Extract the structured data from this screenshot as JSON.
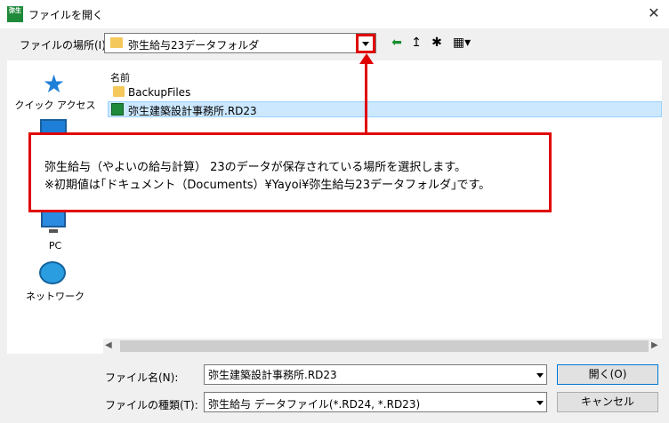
{
  "window": {
    "title": "ファイルを開く",
    "app_icon_text": "弥生",
    "close_glyph": "✕"
  },
  "location": {
    "label": "ファイルの場所(I):",
    "value": "弥生給与23データフォルダ"
  },
  "toolbar": {
    "back_glyph": "⬅",
    "up_glyph": "↥",
    "newfolder_glyph": "✱",
    "view_glyph": "▦▾"
  },
  "sidebar": {
    "items": [
      {
        "label": "クイック アクセス"
      },
      {
        "label": "PC"
      },
      {
        "label": "ネットワーク"
      }
    ]
  },
  "filelist": {
    "column_name": "名前",
    "rows": [
      {
        "name": "BackupFiles"
      },
      {
        "name": "弥生建築設計事務所.RD23"
      }
    ]
  },
  "bottom": {
    "filename_label": "ファイル名(N):",
    "filename_value": "弥生建築設計事務所.RD23",
    "filetype_label": "ファイルの種類(T):",
    "filetype_value": "弥生給与 データファイル(*.RD24, *.RD23)",
    "open_label": "開く(O)",
    "cancel_label": "キャンセル"
  },
  "callout": {
    "line1": "弥生給与（やよいの給与計算） 23のデータが保存されている場所を選択します。",
    "line2": "※初期値は｢ドキュメント（Documents）¥Yayoi¥弥生給与23データフォルダ｣です。"
  },
  "colors": {
    "accent_red": "#e00000",
    "selection": "#cce8ff"
  }
}
